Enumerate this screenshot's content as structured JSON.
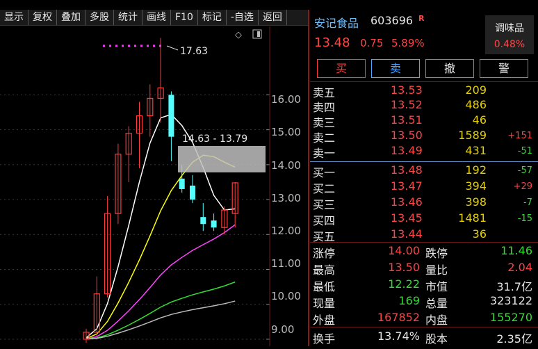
{
  "toolbar": {
    "buttons": [
      "显示",
      "复权",
      "叠加",
      "多股",
      "统计",
      "画线",
      "F10",
      "标记",
      "-自选",
      "返回"
    ]
  },
  "chart": {
    "y_ticks": [
      "16.00",
      "15.00",
      "14.00",
      "13.00",
      "12.00",
      "11.00",
      "10.00",
      "9.00"
    ],
    "high_label": "17.63",
    "range_label": "14.63 - 13.79",
    "colors": {
      "up": "#ff3b3b",
      "down": "#54ffff",
      "ma5": "#ffffff",
      "ma10": "#ffff00",
      "ma20": "#ff44ff",
      "ma30": "#33dd33",
      "ma60": "#bbbbbb"
    }
  },
  "chart_data": {
    "type": "candlestick",
    "ylim": [
      8.8,
      17.8
    ],
    "candles": [
      {
        "o": 9.0,
        "h": 9.3,
        "l": 8.9,
        "c": 9.2
      },
      {
        "o": 9.2,
        "h": 10.8,
        "l": 9.1,
        "c": 10.3
      },
      {
        "o": 10.3,
        "h": 13.1,
        "l": 10.2,
        "c": 12.6
      },
      {
        "o": 12.6,
        "h": 14.6,
        "l": 12.3,
        "c": 14.3
      },
      {
        "o": 14.3,
        "h": 15.1,
        "l": 13.5,
        "c": 14.9
      },
      {
        "o": 14.9,
        "h": 15.8,
        "l": 13.9,
        "c": 15.4
      },
      {
        "o": 15.4,
        "h": 16.3,
        "l": 14.8,
        "c": 15.9
      },
      {
        "o": 15.9,
        "h": 17.63,
        "l": 15.2,
        "c": 16.2
      },
      {
        "o": 16.0,
        "h": 16.1,
        "l": 14.1,
        "c": 14.8
      },
      {
        "o": 13.6,
        "h": 14.0,
        "l": 13.2,
        "c": 13.3
      },
      {
        "o": 13.4,
        "h": 13.7,
        "l": 12.9,
        "c": 13.0
      },
      {
        "o": 12.5,
        "h": 12.9,
        "l": 12.1,
        "c": 12.3
      },
      {
        "o": 12.4,
        "h": 12.6,
        "l": 12.1,
        "c": 12.2
      },
      {
        "o": 12.2,
        "h": 12.8,
        "l": 12.0,
        "c": 12.7
      },
      {
        "o": 12.6,
        "h": 13.5,
        "l": 12.2,
        "c": 13.48
      }
    ]
  },
  "quote": {
    "name": "安记食品",
    "code": "603696",
    "badge": "R",
    "price": "13.48",
    "change": "0.75",
    "pct": "5.89%",
    "sector_name": "调味品",
    "sector_pct": "0.48%"
  },
  "actions": {
    "buy": "买",
    "sell": "卖",
    "cancel": "撤",
    "alert": "警"
  },
  "orderbook": {
    "asks": [
      {
        "label": "卖五",
        "price": "13.53",
        "vol": "209",
        "delta": ""
      },
      {
        "label": "卖四",
        "price": "13.52",
        "vol": "486",
        "delta": ""
      },
      {
        "label": "卖三",
        "price": "13.51",
        "vol": "46",
        "delta": ""
      },
      {
        "label": "卖二",
        "price": "13.50",
        "vol": "1589",
        "delta": "+151"
      },
      {
        "label": "卖一",
        "price": "13.49",
        "vol": "431",
        "delta": "-51"
      }
    ],
    "bids": [
      {
        "label": "买一",
        "price": "13.48",
        "vol": "192",
        "delta": "-57"
      },
      {
        "label": "买二",
        "price": "13.47",
        "vol": "394",
        "delta": "+29"
      },
      {
        "label": "买三",
        "price": "13.46",
        "vol": "398",
        "delta": "-7"
      },
      {
        "label": "买四",
        "price": "13.45",
        "vol": "1481",
        "delta": "-15"
      },
      {
        "label": "买五",
        "price": "13.44",
        "vol": "36",
        "delta": ""
      }
    ]
  },
  "stats": [
    {
      "l1": "涨停",
      "v1": "14.00",
      "l2": "跌停",
      "v2": "11.46"
    },
    {
      "l1": "最高",
      "v1": "13.50",
      "l2": "量比",
      "v2": "2.04"
    },
    {
      "l1": "最低",
      "v1": "12.22",
      "l2": "市值",
      "v2": "31.7亿"
    },
    {
      "l1": "现量",
      "v1": "169",
      "l2": "总量",
      "v2": "323122"
    },
    {
      "l1": "外盘",
      "v1": "167852",
      "l2": "内盘",
      "v2": "155270"
    },
    {
      "l1": "换手",
      "v1": "13.74%",
      "l2": "股本",
      "v2": "2.35亿"
    }
  ]
}
